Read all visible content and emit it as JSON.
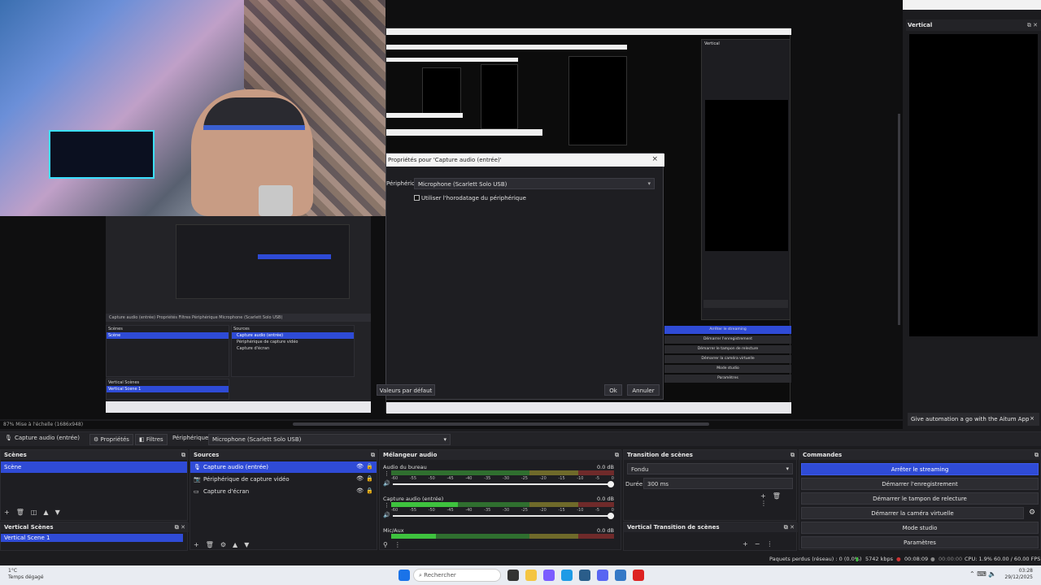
{
  "mirrorDock": {
    "title": "Vertical"
  },
  "dialog": {
    "title": "Propriétés pour 'Capture audio (entrée)'",
    "close": "×",
    "device_label": "Périphérique",
    "device_value": "Microphone (Scarlett Solo USB)",
    "checkbox_label": "Utiliser l'horodatage du périphérique",
    "defaults_button": "Valeurs par défaut",
    "ok_button": "Ok",
    "cancel_button": "Annuler"
  },
  "nested": {
    "toolbar": "Capture audio (entrée)   Propriétés   Filtres   Périphérique   Microphone (Scarlett Solo USB)",
    "scenes": "Scènes",
    "sources": "Sources",
    "scene": "Scène",
    "source1": "Capture audio (entrée)",
    "source2": "Périphérique de capture vidéo",
    "source3": "Capture d'écran",
    "vertical": "Vertical Scènes",
    "vscene": "Vertical Scene 1"
  },
  "mirrorCommands": [
    "Arrêter le streaming",
    "Démarrer l'enregistrement",
    "Démarrer le tampon de relecture",
    "Démarrer la caméra virtuelle",
    "Mode studio",
    "Paramètres"
  ],
  "rightDock": {
    "title": "Vertical",
    "banner": "Give automation a go with the Aitum App",
    "banner_close": "×"
  },
  "zoomStatus": "87%   Mise à l'échelle (1686x948)",
  "toolbar": {
    "source": "Capture audio (entrée)",
    "properties": "Propriétés",
    "filters": "Filtres",
    "device_label": "Périphérique",
    "device_value": "Microphone (Scarlett Solo USB)"
  },
  "scenes": {
    "title": "Scènes",
    "items": [
      "Scène"
    ]
  },
  "verticalScenes": {
    "title": "Vertical Scènes",
    "items": [
      "Vertical Scene 1"
    ]
  },
  "sources": {
    "title": "Sources",
    "items": [
      "Capture audio (entrée)",
      "Périphérique de capture vidéo",
      "Capture d'écran"
    ]
  },
  "mixer": {
    "title": "Mélangeur audio",
    "channels": [
      {
        "name": "Audio du bureau",
        "db": "0.0 dB",
        "level": 0.0
      },
      {
        "name": "Capture audio (entrée)",
        "db": "0.0 dB",
        "level": 0.3
      },
      {
        "name": "Mic/Aux",
        "db": "0.0 dB",
        "level": 0.2
      }
    ],
    "ticks": [
      "-60",
      "-55",
      "-50",
      "-45",
      "-40",
      "-35",
      "-30",
      "-25",
      "-20",
      "-15",
      "-10",
      "-5",
      "0"
    ]
  },
  "transitions": {
    "title": "Transition de scènes",
    "type": "Fondu",
    "duration_label": "Durée",
    "duration_value": "300 ms"
  },
  "verticalTransitions": {
    "title": "Vertical Transition de scènes"
  },
  "commands": {
    "title": "Commandes",
    "stop_streaming": "Arrêter le streaming",
    "start_recording": "Démarrer l'enregistrement",
    "replay_buffer": "Démarrer le tampon de relecture",
    "virtual_camera": "Démarrer la caméra virtuelle",
    "studio_mode": "Mode studio",
    "settings": "Paramètres"
  },
  "status": {
    "dropped": "Paquets perdus (réseau) : 0 (0.0%)",
    "bitrate": "5742 kbps",
    "stream_time": "00:08:09",
    "rec_time": "00:00:00",
    "cpu": "CPU: 1.9%",
    "fps": "60.00 / 60.00 FPS"
  },
  "taskbar": {
    "weather_temp": "1°C",
    "weather_desc": "Temps dégagé",
    "search_placeholder": "Rechercher",
    "time": "03:28",
    "date": "29/12/2025"
  },
  "colors": {
    "accent": "#2f4bd6",
    "meter_green": "#3ec23e",
    "background": "#1c1c1f"
  }
}
